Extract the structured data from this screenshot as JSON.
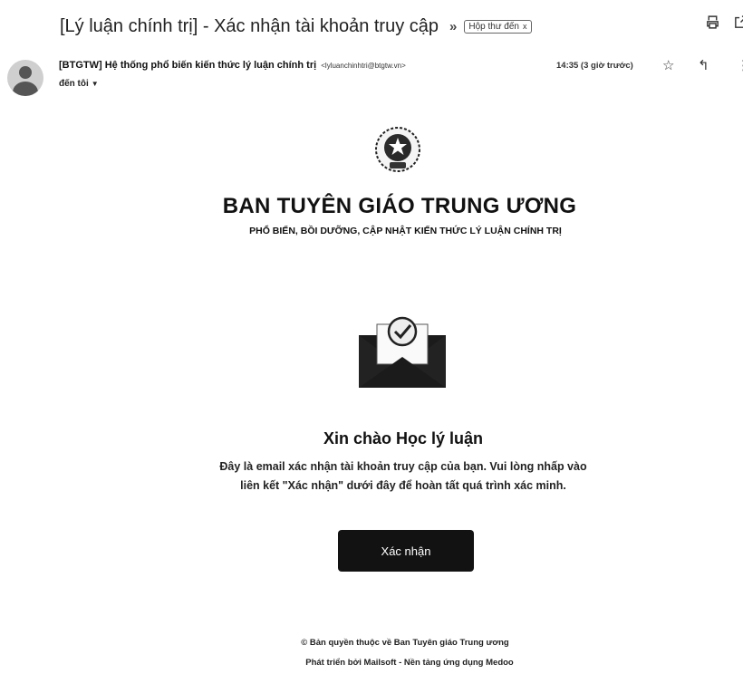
{
  "email": {
    "subject": "[Lý luận chính trị] - Xác nhận tài khoản truy cập",
    "label_chip": "Hộp thư đến",
    "label_chip_close": "x",
    "sender": {
      "name": "[BTGTW] Hệ thống phổ biến kiến thức lý luận chính trị",
      "email": "<lyluanchinhtri@btgtw.vn>",
      "time": "14:35 (3 giờ trước)",
      "to": "đến tôi"
    }
  },
  "content": {
    "org_title": "BAN TUYÊN GIÁO TRUNG ƯƠNG",
    "org_subtitle": "PHỔ BIẾN, BỒI DƯỠNG, CẬP NHẬT KIẾN THỨC LÝ LUẬN CHÍNH TRỊ",
    "greeting": "Xin chào Học lý luận",
    "body_line1": "Đây là email xác nhận tài khoản truy cập của bạn. Vui lòng nhấp vào",
    "body_line2": "liên kết \"Xác nhận\" dưới đây để hoàn tất quá trình xác minh.",
    "confirm_button": "Xác nhận",
    "footer_copyright": "© Bản quyền thuộc về Ban Tuyên giáo Trung ương",
    "footer_dev": "Phát triển bởi Mailsoft - Nền tảng ứng dụng Medoo"
  },
  "icons": {
    "important": "importance-marker-icon",
    "print": "print-icon",
    "open_new": "open-new-window-icon",
    "star": "star-icon",
    "reply": "reply-icon",
    "more": "more-vert-icon",
    "dropdown": "chevron-down-icon"
  },
  "colors": {
    "button_bg": "#121212",
    "button_text": "#ffffff",
    "text": "#111111"
  }
}
